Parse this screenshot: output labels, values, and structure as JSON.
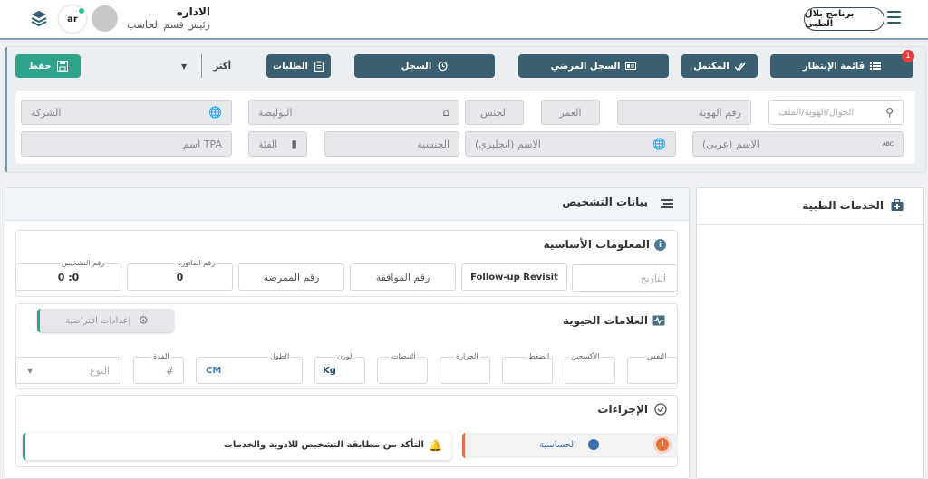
{
  "header": {
    "brand": "برنامج بلال الطبي",
    "user_name": "الاداره",
    "user_role": "رئيس قسم الحاسب",
    "lang": "ar"
  },
  "toolbar": {
    "waiting_list": "قائمة الإنتظار",
    "waiting_badge": "1",
    "completed": "المكتمل",
    "medical_record": "السجل المرضي",
    "record": "السجل",
    "requests": "الطلبات",
    "more": "أكثر",
    "save": "حفظ"
  },
  "patient_form": {
    "search_placeholder": "الجوال/الهوية/الملف",
    "id_number": "رقم الهوية",
    "age": "العمر",
    "gender": "الجنس",
    "policy": "البوليصة",
    "company": "الشركة",
    "name_ar": "الاسم (عربي)",
    "name_ar_tag": "ABC",
    "name_en": "الاسم (انجليزي)",
    "nationality": "الجنسية",
    "category": "الفئة",
    "tpa_name": "اسم TPA"
  },
  "diagnosis": {
    "title": "بيانات التشخيص",
    "basic_info": {
      "title": "المعلومات الأساسية",
      "date_placeholder": "التاريخ",
      "visit_type": "Follow-up Revisit",
      "approval_number": "رقم الموافقة",
      "nurse_number": "رقم الممرضة",
      "invoice_label": "رقم الفاتورة",
      "invoice_value": "0",
      "diagnosis_label": "رقم التشخيص",
      "diagnosis_value": "0 :0"
    },
    "vitals": {
      "title": "العلامات الحيوية",
      "defaults_button": "إعدادات افتراضية",
      "breath": "النفس",
      "oxygen": "الأكسجين",
      "pressure": "الضغط",
      "temperature": "الحرارة",
      "pulse": "النبضات",
      "weight": "الوزن",
      "weight_unit": "Kg",
      "height": "الطول",
      "height_unit": "CM",
      "duration": "المدة",
      "duration_value": "#",
      "type_placeholder": "النوع"
    },
    "procedures": {
      "title": "الإجراءات",
      "alert_count": "!",
      "allergy": "الحساسية",
      "match_check": "التأكد من مطابقة التشخيص للادوية والخدمات"
    }
  },
  "services": {
    "title": "الخدمات الطبية"
  },
  "colors": {
    "primary": "#3a5f70",
    "accent": "#2fa38c",
    "alert": "#e43d3d",
    "orange": "#e8703a"
  }
}
